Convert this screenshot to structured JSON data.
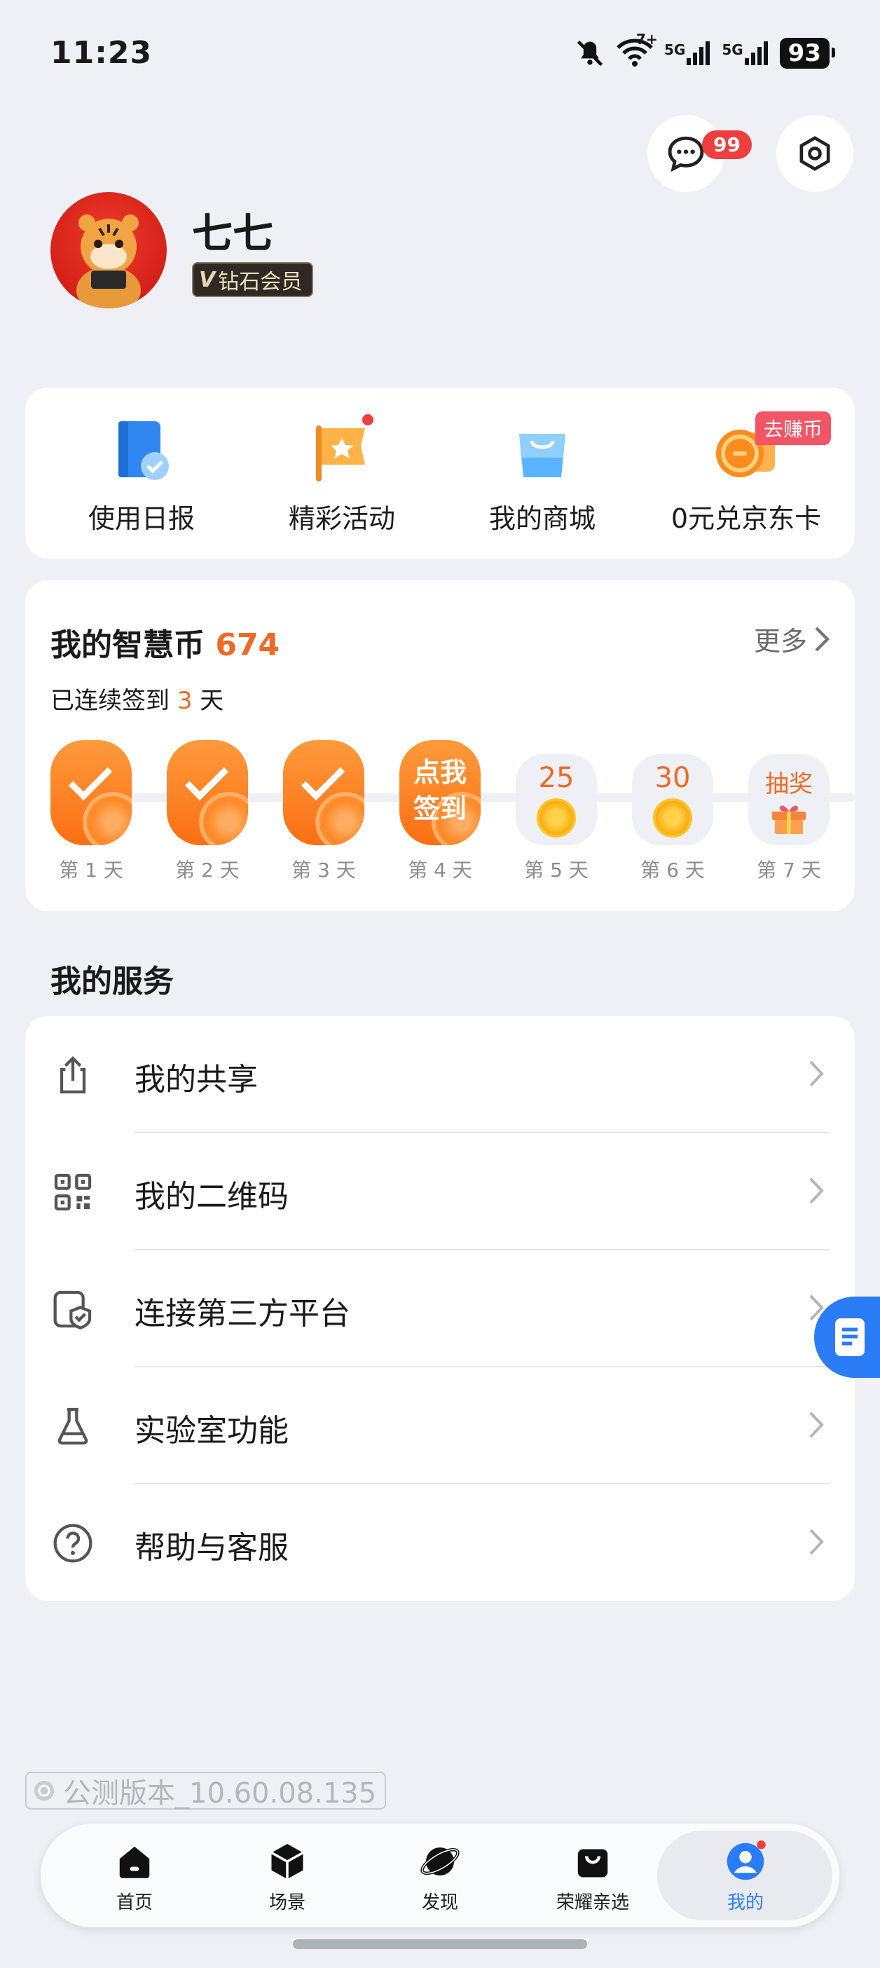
{
  "status_bar": {
    "time": "11:23",
    "signal1": "5G",
    "signal2": "5G",
    "wifi_label": "7+",
    "battery": "93"
  },
  "header": {
    "message_badge": "99"
  },
  "profile": {
    "name": "七七",
    "vip_label": "钻石会员"
  },
  "quick_actions": [
    {
      "label": "使用日报",
      "icon": "daily-report-icon"
    },
    {
      "label": "精彩活动",
      "icon": "activity-flag-icon"
    },
    {
      "label": "我的商城",
      "icon": "shopping-bag-icon"
    },
    {
      "label": "0元兑京东卡",
      "icon": "coin-card-icon",
      "tag": "去赚币"
    }
  ],
  "coins": {
    "title": "我的智慧币",
    "value": "674",
    "more": "更多",
    "streak_prefix": "已连续签到",
    "streak_days": "3",
    "streak_suffix": "天",
    "days": [
      {
        "label": "第 1 天",
        "state": "done"
      },
      {
        "label": "第 2 天",
        "state": "done"
      },
      {
        "label": "第 3 天",
        "state": "done"
      },
      {
        "label": "第 4 天",
        "state": "today",
        "text1": "点我",
        "text2": "签到"
      },
      {
        "label": "第 5 天",
        "state": "future",
        "value": "25"
      },
      {
        "label": "第 6 天",
        "state": "future",
        "value": "30"
      },
      {
        "label": "第 7 天",
        "state": "prize",
        "value": "抽奖"
      }
    ]
  },
  "services": {
    "title": "我的服务",
    "items": [
      {
        "label": "我的共享",
        "icon": "share-icon"
      },
      {
        "label": "我的二维码",
        "icon": "qr-code-icon"
      },
      {
        "label": "连接第三方平台",
        "icon": "third-party-shield-icon"
      },
      {
        "label": "实验室功能",
        "icon": "flask-icon"
      },
      {
        "label": "帮助与客服",
        "icon": "help-icon"
      }
    ]
  },
  "version": "公测版本_10.60.08.135",
  "nav": [
    {
      "label": "首页",
      "icon": "home-icon"
    },
    {
      "label": "场景",
      "icon": "cube-icon"
    },
    {
      "label": "发现",
      "icon": "planet-icon"
    },
    {
      "label": "荣耀亲选",
      "icon": "bag-icon"
    },
    {
      "label": "我的",
      "icon": "profile-icon",
      "active": true
    }
  ],
  "colors": {
    "accent": "#2a7bf6",
    "coin_orange": "#ef6a26",
    "badge_red": "#f03d3d"
  }
}
